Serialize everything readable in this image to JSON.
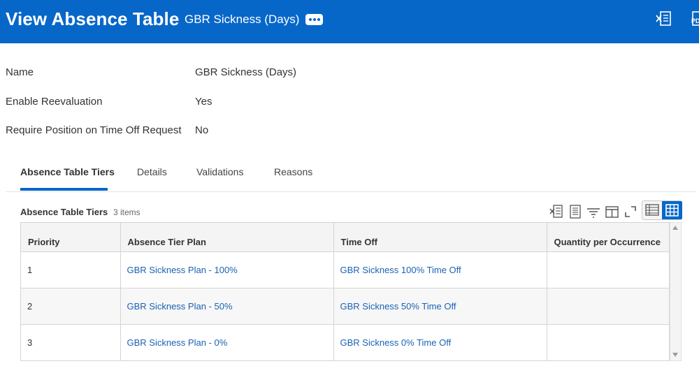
{
  "header": {
    "title": "View Absence Table",
    "subtitle": "GBR Sickness (Days)",
    "related_actions_icon": "more-horizontal-icon",
    "excel_icon": "export-excel-icon",
    "pdf_icon": "export-pdf-icon",
    "background_color": "#0767c9"
  },
  "fields": [
    {
      "label": "Name",
      "value": "GBR Sickness (Days)"
    },
    {
      "label": "Enable Reevaluation",
      "value": "Yes"
    },
    {
      "label": "Require Position on Time Off Request",
      "value": "No"
    }
  ],
  "tabs": [
    {
      "label": "Absence Table Tiers",
      "active": true
    },
    {
      "label": "Details",
      "active": false
    },
    {
      "label": "Validations",
      "active": false
    },
    {
      "label": "Reasons",
      "active": false
    }
  ],
  "grid": {
    "title": "Absence Table Tiers",
    "count": "3 items",
    "toolbar_icons": [
      "export-excel-icon",
      "export-pdf-icon",
      "filter-icon",
      "column-config-icon",
      "fullscreen-icon",
      "list-view-icon",
      "grid-view-icon"
    ],
    "columns": [
      "Priority",
      "Absence Tier Plan",
      "Time Off",
      "Quantity per Occurrence"
    ],
    "rows": [
      {
        "priority": "1",
        "plan": "GBR Sickness Plan - 100%",
        "time_off": "GBR Sickness 100% Time Off",
        "quantity": ""
      },
      {
        "priority": "2",
        "plan": "GBR Sickness Plan - 50%",
        "time_off": "GBR Sickness 50% Time Off",
        "quantity": ""
      },
      {
        "priority": "3",
        "plan": "GBR Sickness Plan - 0%",
        "time_off": "GBR Sickness 0% Time Off",
        "quantity": ""
      }
    ],
    "link_color": "#1a62b4"
  }
}
